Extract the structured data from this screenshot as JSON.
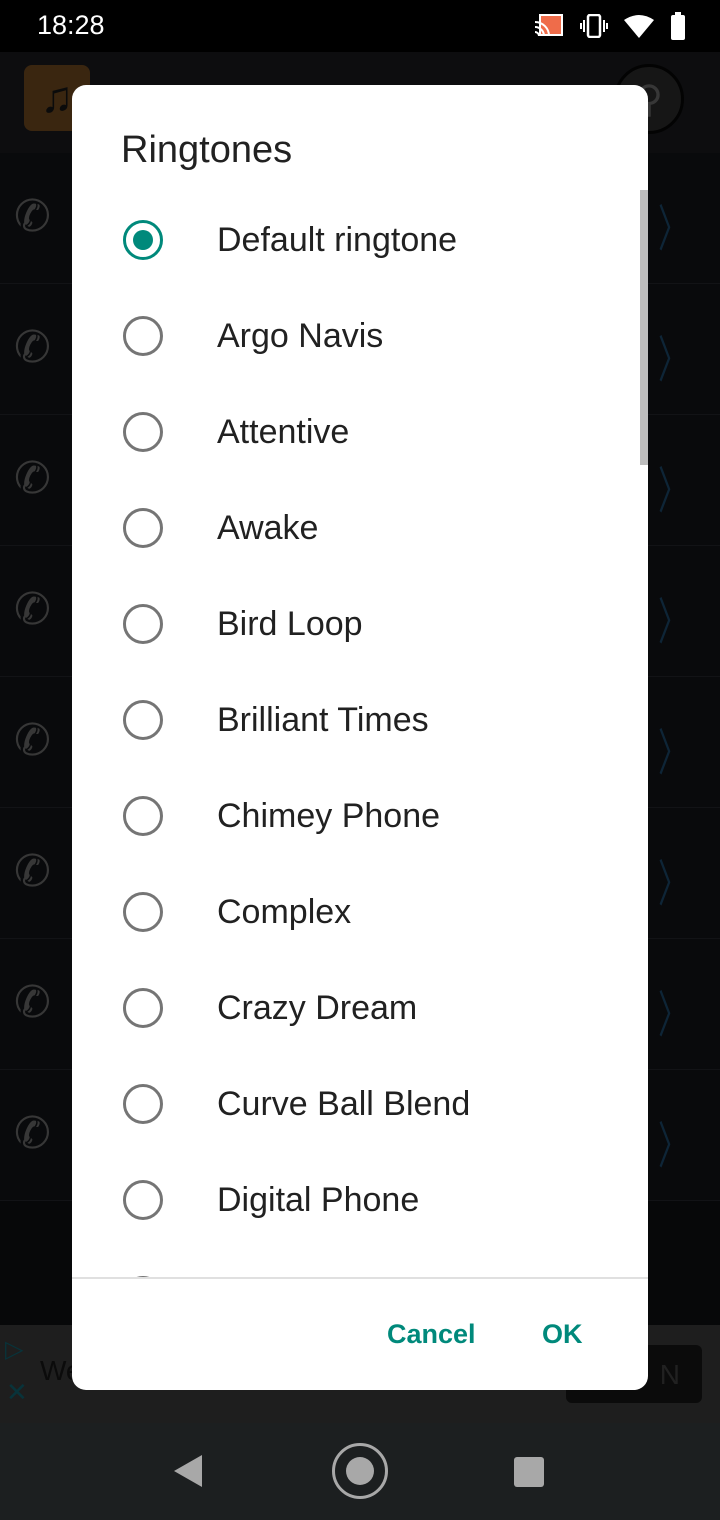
{
  "status_bar": {
    "time": "18:28",
    "icons": [
      "cast-icon",
      "vibrate-icon",
      "wifi-icon",
      "battery-icon"
    ]
  },
  "app_bar": {
    "logo_icon": "music-note-icon",
    "search_icon": "search-icon"
  },
  "background_rows": [
    {
      "icon": "phone-icon"
    },
    {
      "icon": "phone-icon"
    },
    {
      "icon": "phone-icon"
    },
    {
      "icon": "phone-icon"
    },
    {
      "icon": "phone-icon"
    },
    {
      "icon": "phone-icon"
    },
    {
      "icon": "phone-icon"
    },
    {
      "icon": "phone-icon"
    }
  ],
  "ad": {
    "text": "We",
    "button": "N"
  },
  "dialog": {
    "title": "Ringtones",
    "options": [
      {
        "label": "Default ringtone",
        "selected": true
      },
      {
        "label": "Argo Navis",
        "selected": false
      },
      {
        "label": "Attentive",
        "selected": false
      },
      {
        "label": "Awake",
        "selected": false
      },
      {
        "label": "Bird Loop",
        "selected": false
      },
      {
        "label": "Brilliant Times",
        "selected": false
      },
      {
        "label": "Chimey Phone",
        "selected": false
      },
      {
        "label": "Complex",
        "selected": false
      },
      {
        "label": "Crazy Dream",
        "selected": false
      },
      {
        "label": "Curve Ball Blend",
        "selected": false
      },
      {
        "label": "Digital Phone",
        "selected": false
      }
    ],
    "cancel_label": "Cancel",
    "ok_label": "OK",
    "accent_color": "#00897b"
  }
}
